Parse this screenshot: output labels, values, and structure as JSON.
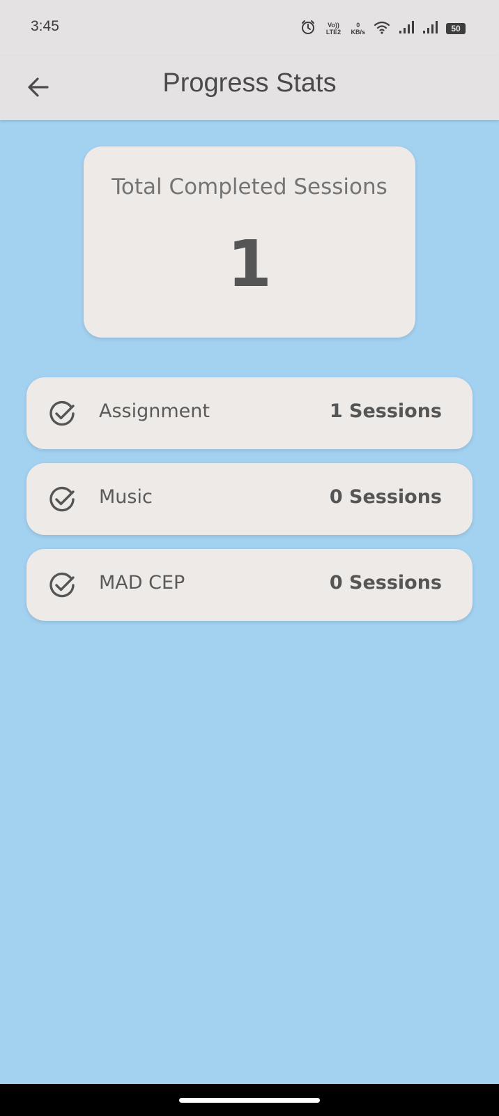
{
  "status_bar": {
    "time": "3:45",
    "volte": "Vo)) LTE2",
    "net_speed_value": "0",
    "net_speed_unit": "KB/s",
    "battery": "50",
    "icons": [
      "alarm-icon",
      "volte-icon",
      "net-speed",
      "wifi-icon",
      "signal-icon",
      "signal-icon",
      "battery-icon"
    ]
  },
  "app_bar": {
    "title": "Progress Stats",
    "back_icon": "arrow-left-icon"
  },
  "total": {
    "label": "Total Completed Sessions",
    "value": "1"
  },
  "items": [
    {
      "name": "Assignment",
      "count": "1 Sessions",
      "icon": "check-circle-icon"
    },
    {
      "name": "Music",
      "count": "0 Sessions",
      "icon": "check-circle-icon"
    },
    {
      "name": "MAD CEP",
      "count": "0 Sessions",
      "icon": "check-circle-icon"
    }
  ],
  "colors": {
    "background": "#a3d1f0",
    "card": "#edeae7",
    "app_bar": "#e5e2e3",
    "text": "#555555"
  }
}
